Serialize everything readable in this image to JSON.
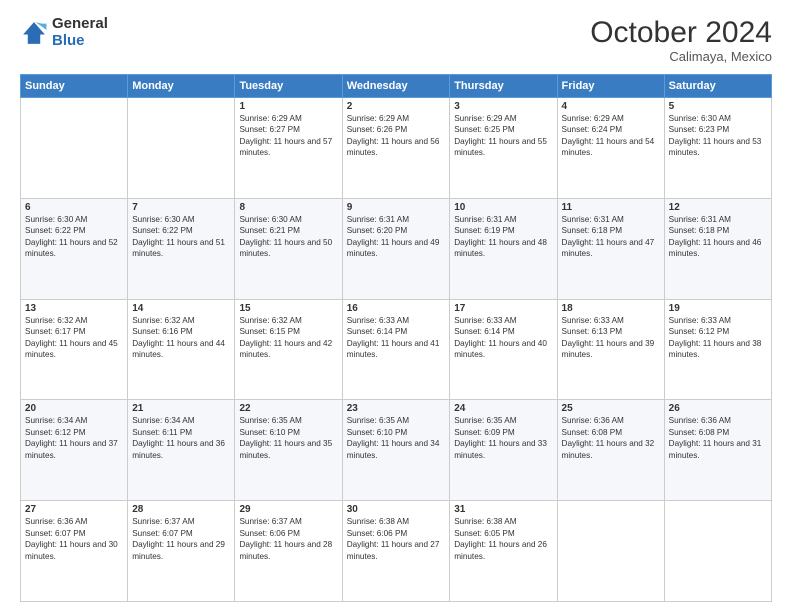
{
  "logo": {
    "general": "General",
    "blue": "Blue"
  },
  "header": {
    "month": "October 2024",
    "location": "Calimaya, Mexico"
  },
  "days_of_week": [
    "Sunday",
    "Monday",
    "Tuesday",
    "Wednesday",
    "Thursday",
    "Friday",
    "Saturday"
  ],
  "weeks": [
    [
      {
        "day": "",
        "info": ""
      },
      {
        "day": "",
        "info": ""
      },
      {
        "day": "1",
        "info": "Sunrise: 6:29 AM\nSunset: 6:27 PM\nDaylight: 11 hours and 57 minutes."
      },
      {
        "day": "2",
        "info": "Sunrise: 6:29 AM\nSunset: 6:26 PM\nDaylight: 11 hours and 56 minutes."
      },
      {
        "day": "3",
        "info": "Sunrise: 6:29 AM\nSunset: 6:25 PM\nDaylight: 11 hours and 55 minutes."
      },
      {
        "day": "4",
        "info": "Sunrise: 6:29 AM\nSunset: 6:24 PM\nDaylight: 11 hours and 54 minutes."
      },
      {
        "day": "5",
        "info": "Sunrise: 6:30 AM\nSunset: 6:23 PM\nDaylight: 11 hours and 53 minutes."
      }
    ],
    [
      {
        "day": "6",
        "info": "Sunrise: 6:30 AM\nSunset: 6:22 PM\nDaylight: 11 hours and 52 minutes."
      },
      {
        "day": "7",
        "info": "Sunrise: 6:30 AM\nSunset: 6:22 PM\nDaylight: 11 hours and 51 minutes."
      },
      {
        "day": "8",
        "info": "Sunrise: 6:30 AM\nSunset: 6:21 PM\nDaylight: 11 hours and 50 minutes."
      },
      {
        "day": "9",
        "info": "Sunrise: 6:31 AM\nSunset: 6:20 PM\nDaylight: 11 hours and 49 minutes."
      },
      {
        "day": "10",
        "info": "Sunrise: 6:31 AM\nSunset: 6:19 PM\nDaylight: 11 hours and 48 minutes."
      },
      {
        "day": "11",
        "info": "Sunrise: 6:31 AM\nSunset: 6:18 PM\nDaylight: 11 hours and 47 minutes."
      },
      {
        "day": "12",
        "info": "Sunrise: 6:31 AM\nSunset: 6:18 PM\nDaylight: 11 hours and 46 minutes."
      }
    ],
    [
      {
        "day": "13",
        "info": "Sunrise: 6:32 AM\nSunset: 6:17 PM\nDaylight: 11 hours and 45 minutes."
      },
      {
        "day": "14",
        "info": "Sunrise: 6:32 AM\nSunset: 6:16 PM\nDaylight: 11 hours and 44 minutes."
      },
      {
        "day": "15",
        "info": "Sunrise: 6:32 AM\nSunset: 6:15 PM\nDaylight: 11 hours and 42 minutes."
      },
      {
        "day": "16",
        "info": "Sunrise: 6:33 AM\nSunset: 6:14 PM\nDaylight: 11 hours and 41 minutes."
      },
      {
        "day": "17",
        "info": "Sunrise: 6:33 AM\nSunset: 6:14 PM\nDaylight: 11 hours and 40 minutes."
      },
      {
        "day": "18",
        "info": "Sunrise: 6:33 AM\nSunset: 6:13 PM\nDaylight: 11 hours and 39 minutes."
      },
      {
        "day": "19",
        "info": "Sunrise: 6:33 AM\nSunset: 6:12 PM\nDaylight: 11 hours and 38 minutes."
      }
    ],
    [
      {
        "day": "20",
        "info": "Sunrise: 6:34 AM\nSunset: 6:12 PM\nDaylight: 11 hours and 37 minutes."
      },
      {
        "day": "21",
        "info": "Sunrise: 6:34 AM\nSunset: 6:11 PM\nDaylight: 11 hours and 36 minutes."
      },
      {
        "day": "22",
        "info": "Sunrise: 6:35 AM\nSunset: 6:10 PM\nDaylight: 11 hours and 35 minutes."
      },
      {
        "day": "23",
        "info": "Sunrise: 6:35 AM\nSunset: 6:10 PM\nDaylight: 11 hours and 34 minutes."
      },
      {
        "day": "24",
        "info": "Sunrise: 6:35 AM\nSunset: 6:09 PM\nDaylight: 11 hours and 33 minutes."
      },
      {
        "day": "25",
        "info": "Sunrise: 6:36 AM\nSunset: 6:08 PM\nDaylight: 11 hours and 32 minutes."
      },
      {
        "day": "26",
        "info": "Sunrise: 6:36 AM\nSunset: 6:08 PM\nDaylight: 11 hours and 31 minutes."
      }
    ],
    [
      {
        "day": "27",
        "info": "Sunrise: 6:36 AM\nSunset: 6:07 PM\nDaylight: 11 hours and 30 minutes."
      },
      {
        "day": "28",
        "info": "Sunrise: 6:37 AM\nSunset: 6:07 PM\nDaylight: 11 hours and 29 minutes."
      },
      {
        "day": "29",
        "info": "Sunrise: 6:37 AM\nSunset: 6:06 PM\nDaylight: 11 hours and 28 minutes."
      },
      {
        "day": "30",
        "info": "Sunrise: 6:38 AM\nSunset: 6:06 PM\nDaylight: 11 hours and 27 minutes."
      },
      {
        "day": "31",
        "info": "Sunrise: 6:38 AM\nSunset: 6:05 PM\nDaylight: 11 hours and 26 minutes."
      },
      {
        "day": "",
        "info": ""
      },
      {
        "day": "",
        "info": ""
      }
    ]
  ]
}
